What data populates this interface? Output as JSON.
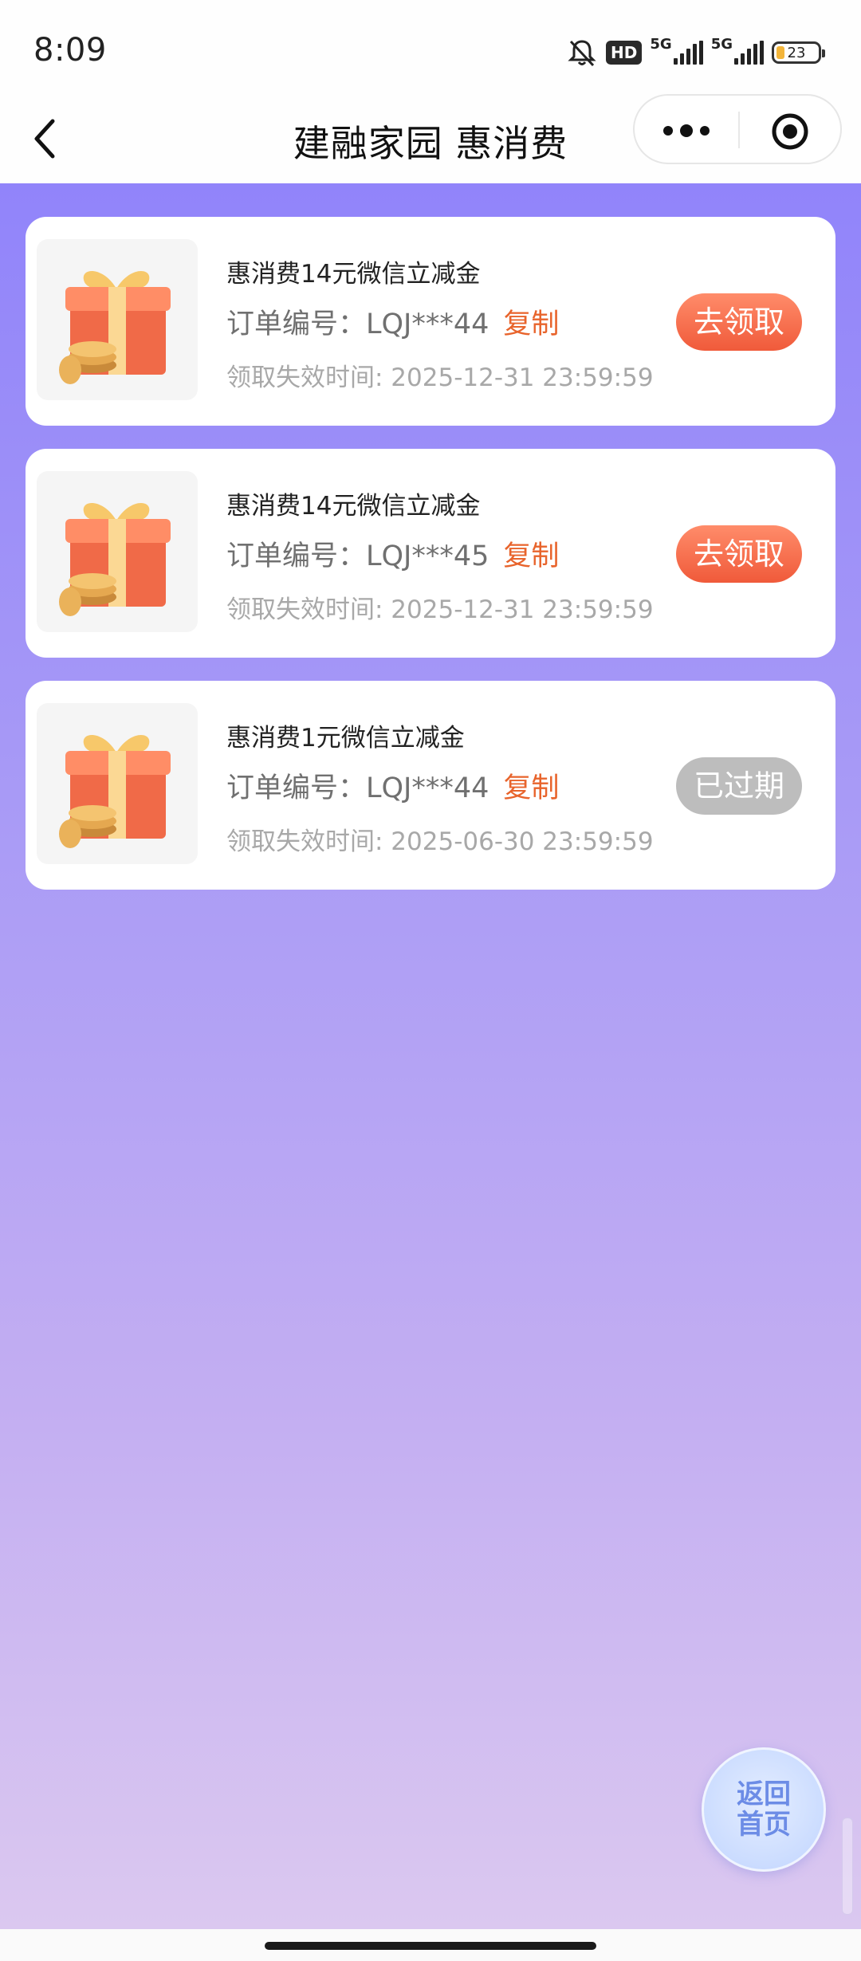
{
  "status_bar": {
    "time": "8:09",
    "hd_label": "HD",
    "net1_label": "5G",
    "net2_label": "5G",
    "battery_level": "23",
    "icons": [
      "bell-muted-icon",
      "hd-icon",
      "signal-5g-icon",
      "signal-5g-icon",
      "battery-icon"
    ]
  },
  "nav": {
    "title": "建融家园 惠消费",
    "back_icon": "chevron-left-icon",
    "more_icon": "more-dots-icon",
    "close_icon": "target-icon"
  },
  "vouchers": [
    {
      "title": "惠消费14元微信立减金",
      "order": "订单编号：LQJ***44",
      "copy_label": "复制",
      "expire": "领取失效时间: 2025-12-31 23:59:59",
      "action_label": "去领取",
      "state": "claimable"
    },
    {
      "title": "惠消费14元微信立减金",
      "order": "订单编号：LQJ***45",
      "copy_label": "复制",
      "expire": "领取失效时间: 2025-12-31 23:59:59",
      "action_label": "去领取",
      "state": "claimable"
    },
    {
      "title": "惠消费1元微信立减金",
      "order": "订单编号：LQJ***44",
      "copy_label": "复制",
      "expire": "领取失效时间: 2025-06-30 23:59:59",
      "action_label": "已过期",
      "state": "expired"
    }
  ],
  "home_button": {
    "line1": "返回",
    "line2": "首页"
  },
  "colors": {
    "accent_orange": "#e8642c",
    "claim_button": "#f26a48",
    "expired_button": "#bdbdbd",
    "background_top": "#9184fa",
    "background_bottom": "#dbc8f0"
  }
}
